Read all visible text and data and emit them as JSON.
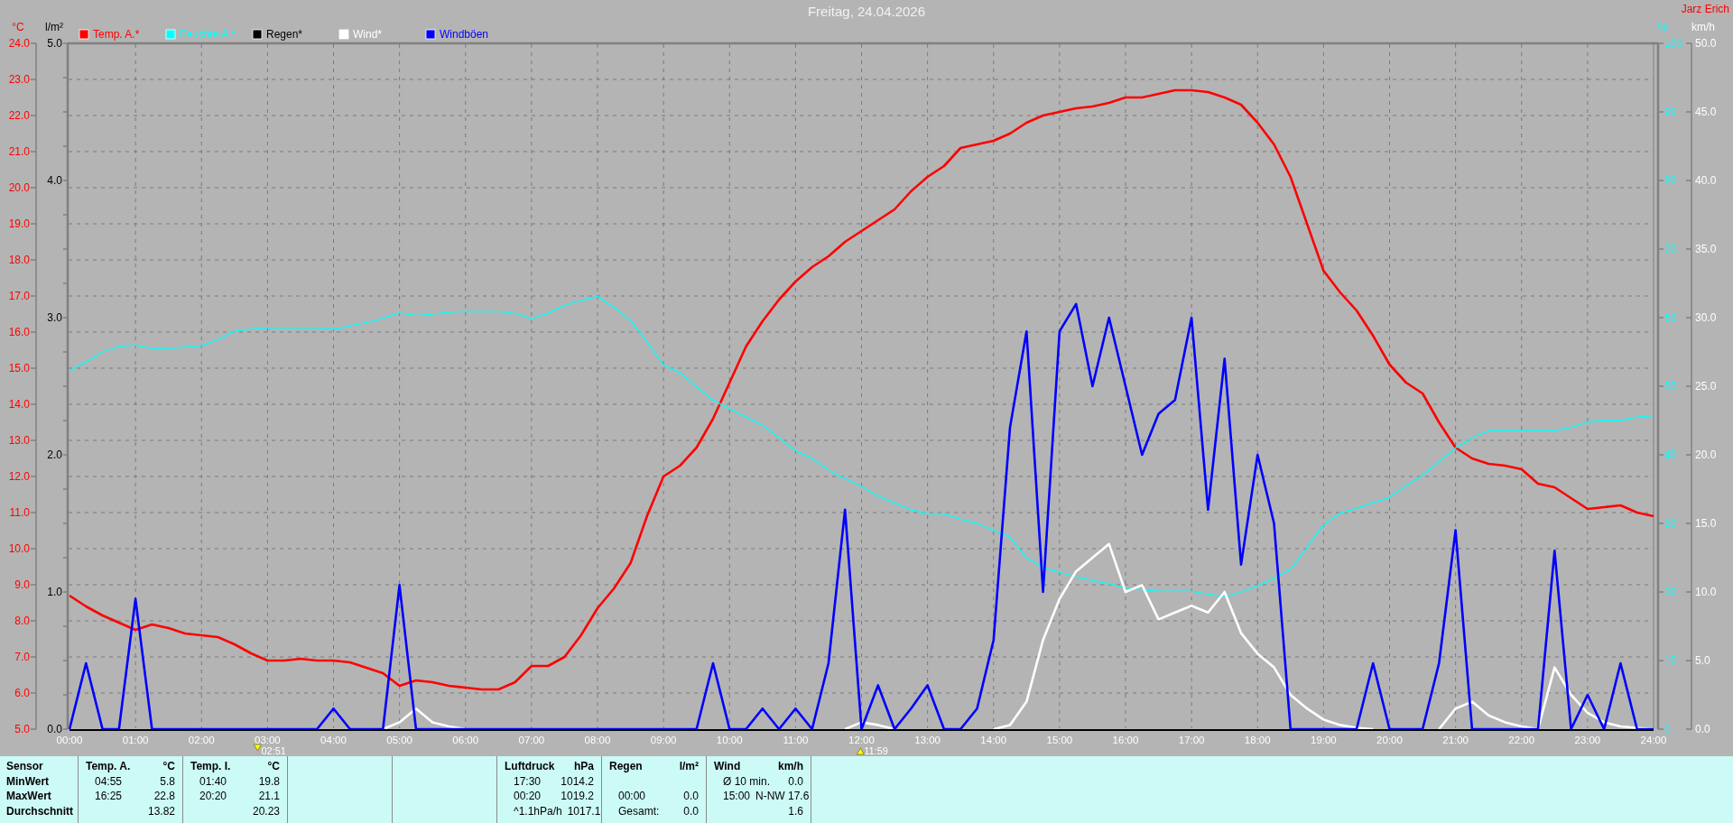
{
  "chart": {
    "title": "Freitag, 24.04.2026",
    "author": "Jarz Erich",
    "charts": [
      {
        "chart_data": {
          "type": "line",
          "ylabel": "°C",
          "xlim": [
            0,
            24
          ],
          "ylim": [
            5,
            24
          ],
          "yticks": [
            {
              "value": 5,
              "label": "5.0"
            },
            {
              "value": 6,
              "label": "6.0"
            },
            {
              "value": 7,
              "label": "7.0"
            },
            {
              "value": 8,
              "label": "8.0"
            },
            {
              "value": 9,
              "label": "9.0"
            },
            {
              "value": 10,
              "label": "10.0"
            },
            {
              "value": 11,
              "label": "11.0"
            },
            {
              "value": 12,
              "label": "12.0"
            },
            {
              "value": 13,
              "label": "13.0"
            },
            {
              "value": 14,
              "label": "14.0"
            },
            {
              "value": 15,
              "label": "15.0"
            },
            {
              "value": 16,
              "label": "16.0"
            },
            {
              "value": 17,
              "label": "17.0"
            },
            {
              "value": 18,
              "label": "18.0"
            },
            {
              "value": 19,
              "label": "19.0"
            },
            {
              "value": 20,
              "label": "20.0"
            },
            {
              "value": 21,
              "label": "21.0"
            },
            {
              "value": 22,
              "label": "22.0"
            },
            {
              "value": 23,
              "label": "23.0"
            },
            {
              "value": 24,
              "label": "24.0"
            }
          ],
          "xticks": [
            {
              "value": 0,
              "label": "00:00"
            },
            {
              "value": 1,
              "label": "01:00"
            },
            {
              "value": 2,
              "label": "02:00"
            },
            {
              "value": 3,
              "label": "03:00"
            },
            {
              "value": 4,
              "label": "04:00"
            },
            {
              "value": 5,
              "label": "05:00"
            },
            {
              "value": 6,
              "label": "06:00"
            },
            {
              "value": 7,
              "label": "07:00"
            },
            {
              "value": 8,
              "label": "08:00"
            },
            {
              "value": 9,
              "label": "09:00"
            },
            {
              "value": 10,
              "label": "10:00"
            },
            {
              "value": 11,
              "label": "11:00"
            },
            {
              "value": 12,
              "label": "12:00"
            },
            {
              "value": 13,
              "label": "13:00"
            },
            {
              "value": 14,
              "label": "14:00"
            },
            {
              "value": 15,
              "label": "15:00"
            },
            {
              "value": 16,
              "label": "16:00"
            },
            {
              "value": 17,
              "label": "17:00"
            },
            {
              "value": 18,
              "label": "18:00"
            },
            {
              "value": 19,
              "label": "19:00"
            },
            {
              "value": 20,
              "label": "20:00"
            },
            {
              "value": 21,
              "label": "21:00"
            },
            {
              "value": 22,
              "label": "22:00"
            },
            {
              "value": 23,
              "label": "23:00"
            },
            {
              "value": 24,
              "label": "24:00"
            }
          ],
          "x": [
            0,
            0.25,
            0.5,
            0.75,
            1,
            1.25,
            1.5,
            1.75,
            2,
            2.25,
            2.5,
            2.75,
            3,
            3.25,
            3.5,
            3.75,
            4,
            4.25,
            4.5,
            4.75,
            5,
            5.25,
            5.5,
            5.75,
            6,
            6.25,
            6.5,
            6.75,
            7,
            7.25,
            7.5,
            7.75,
            8,
            8.25,
            8.5,
            8.75,
            9,
            9.25,
            9.5,
            9.75,
            10,
            10.25,
            10.5,
            10.75,
            11,
            11.25,
            11.5,
            11.75,
            12,
            12.25,
            12.5,
            12.75,
            13,
            13.25,
            13.5,
            13.75,
            14,
            14.25,
            14.5,
            14.75,
            15,
            15.25,
            15.5,
            15.75,
            16,
            16.25,
            16.5,
            16.75,
            17,
            17.25,
            17.5,
            17.75,
            18,
            18.25,
            18.5,
            18.75,
            19,
            19.25,
            19.5,
            19.75,
            20,
            20.25,
            20.5,
            20.75,
            21,
            21.25,
            21.5,
            21.75,
            22,
            22.25,
            22.5,
            22.75,
            23,
            23.25,
            23.5,
            23.75,
            24
          ],
          "series": [
            {
              "name": "Temp. A.*",
              "color": "#ff0000",
              "values": [
                8.7,
                8.4,
                8.15,
                7.95,
                7.75,
                7.9,
                7.8,
                7.65,
                7.6,
                7.55,
                7.35,
                7.1,
                6.9,
                6.9,
                6.95,
                6.9,
                6.9,
                6.85,
                6.7,
                6.55,
                6.2,
                6.35,
                6.3,
                6.2,
                6.15,
                6.1,
                6.1,
                6.3,
                6.75,
                6.75,
                7.0,
                7.6,
                8.35,
                8.9,
                9.6,
                10.9,
                12.0,
                12.3,
                12.8,
                13.6,
                14.6,
                15.6,
                16.3,
                16.9,
                17.4,
                17.8,
                18.1,
                18.5,
                18.8,
                19.1,
                19.4,
                19.9,
                20.3,
                20.6,
                21.1,
                21.2,
                21.3,
                21.5,
                21.8,
                22.0,
                22.1,
                22.2,
                22.25,
                22.35,
                22.5,
                22.5,
                22.6,
                22.7,
                22.7,
                22.65,
                22.5,
                22.3,
                21.8,
                21.2,
                20.3,
                19.0,
                17.7,
                17.1,
                16.6,
                15.9,
                15.1,
                14.6,
                14.3,
                13.5,
                12.8,
                12.5,
                12.35,
                12.3,
                12.2,
                11.8,
                11.7,
                11.4,
                11.1,
                11.15,
                11.2,
                11.0,
                10.9
              ]
            }
          ],
          "annotations": [
            "02:51",
            "11:59"
          ],
          "legend": "top"
        }
      },
      {
        "chart_data": {
          "type": "line",
          "legend": "top",
          "ylabel": "%",
          "xlim": [
            0,
            24
          ],
          "ylim": [
            0,
            100
          ],
          "yticks": [
            0,
            10,
            20,
            30,
            40,
            50,
            60,
            70,
            80,
            90,
            100
          ],
          "x": [
            0,
            0.25,
            0.5,
            0.75,
            1,
            1.25,
            1.5,
            1.75,
            2,
            2.25,
            2.5,
            2.75,
            3,
            3.25,
            3.5,
            3.75,
            4,
            4.25,
            4.5,
            4.75,
            5,
            5.25,
            5.5,
            5.75,
            6,
            6.25,
            6.5,
            6.75,
            7,
            7.25,
            7.5,
            7.75,
            8,
            8.25,
            8.5,
            8.75,
            9,
            9.25,
            9.5,
            9.75,
            10,
            10.25,
            10.5,
            10.75,
            11,
            11.25,
            11.5,
            11.75,
            12,
            12.25,
            12.5,
            12.75,
            13,
            13.25,
            13.5,
            13.75,
            14,
            14.25,
            14.5,
            14.75,
            15,
            15.25,
            15.5,
            15.75,
            16,
            16.25,
            16.5,
            16.75,
            17,
            17.25,
            17.5,
            17.75,
            18,
            18.25,
            18.5,
            18.75,
            19,
            19.25,
            19.5,
            19.75,
            20,
            20.25,
            20.5,
            20.75,
            21,
            21.25,
            21.5,
            21.75,
            22,
            22.25,
            22.5,
            22.75,
            23,
            23.25,
            23.5,
            23.75,
            24
          ],
          "series": [
            {
              "name": "Feuchte A.*",
              "color": "#00ffff",
              "values": [
                52.3,
                53.5,
                55,
                55.8,
                56,
                55.5,
                55.5,
                55.7,
                55.9,
                56.8,
                58,
                58.3,
                58.5,
                58.5,
                58.5,
                58.5,
                58.3,
                58.8,
                59.3,
                59.9,
                60.7,
                60.3,
                60.5,
                60.8,
                60.9,
                60.9,
                60.9,
                60.6,
                59.9,
                60.6,
                61.8,
                62.5,
                63.1,
                61.5,
                59.6,
                56.5,
                53.1,
                52,
                49.9,
                48,
                46.7,
                45.5,
                44.3,
                42.5,
                40.6,
                39.5,
                37.8,
                36.5,
                35.4,
                34,
                33,
                32,
                31.4,
                31.4,
                30.6,
                30,
                29,
                28,
                25,
                23.5,
                22.9,
                22.2,
                21.7,
                21.2,
                20.6,
                20.3,
                20.1,
                20.1,
                20.1,
                19.7,
                19.3,
                20,
                20.9,
                22,
                23.3,
                26.5,
                29.8,
                31.5,
                32.2,
                33,
                33.8,
                35.5,
                37,
                39,
                41,
                42.5,
                43.5,
                43.5,
                43.5,
                43.5,
                43.5,
                44,
                44.8,
                45,
                45,
                45.5,
                45.7
              ]
            }
          ]
        }
      },
      {
        "chart_data": {
          "type": "line",
          "legend": "top",
          "ylabel": "l/m²",
          "xlim": [
            0,
            24
          ],
          "ylim": [
            0,
            5
          ],
          "yticks": [
            {
              "value": 0,
              "label": "0.0"
            },
            {
              "value": 1,
              "label": "1.0"
            },
            {
              "value": 2,
              "label": "2.0"
            },
            {
              "value": 3,
              "label": "3.0"
            },
            {
              "value": 4,
              "label": "4.0"
            },
            {
              "value": 5,
              "label": "5.0"
            }
          ],
          "x": [
            0,
            0.25,
            0.5,
            0.75,
            1,
            1.25,
            1.5,
            1.75,
            2,
            2.25,
            2.5,
            2.75,
            3,
            3.25,
            3.5,
            3.75,
            4,
            4.25,
            4.5,
            4.75,
            5,
            5.25,
            5.5,
            5.75,
            6,
            6.25,
            6.5,
            6.75,
            7,
            7.25,
            7.5,
            7.75,
            8,
            8.25,
            8.5,
            8.75,
            9,
            9.25,
            9.5,
            9.75,
            10,
            10.25,
            10.5,
            10.75,
            11,
            11.25,
            11.5,
            11.75,
            12,
            12.25,
            12.5,
            12.75,
            13,
            13.25,
            13.5,
            13.75,
            14,
            14.25,
            14.5,
            14.75,
            15,
            15.25,
            15.5,
            15.75,
            16,
            16.25,
            16.5,
            16.75,
            17,
            17.25,
            17.5,
            17.75,
            18,
            18.25,
            18.5,
            18.75,
            19,
            19.25,
            19.5,
            19.75,
            20,
            20.25,
            20.5,
            20.75,
            21,
            21.25,
            21.5,
            21.75,
            22,
            22.25,
            22.5,
            22.75,
            23,
            23.25,
            23.5,
            23.75,
            24
          ],
          "series": [
            {
              "name": "Regen*",
              "color": "#000000",
              "values": [
                0,
                0,
                0,
                0,
                0,
                0,
                0,
                0,
                0,
                0,
                0,
                0,
                0,
                0,
                0,
                0,
                0,
                0,
                0,
                0,
                0,
                0,
                0,
                0,
                0,
                0,
                0,
                0,
                0,
                0,
                0,
                0,
                0,
                0,
                0,
                0,
                0,
                0,
                0,
                0,
                0,
                0,
                0,
                0,
                0,
                0,
                0,
                0,
                0,
                0,
                0,
                0,
                0,
                0,
                0,
                0,
                0,
                0,
                0,
                0,
                0,
                0,
                0,
                0,
                0,
                0,
                0,
                0,
                0,
                0,
                0,
                0,
                0,
                0,
                0,
                0,
                0,
                0,
                0,
                0,
                0,
                0,
                0,
                0,
                0,
                0,
                0,
                0,
                0,
                0,
                0,
                0,
                0,
                0,
                0,
                0,
                0
              ]
            }
          ]
        }
      },
      {
        "chart_data": {
          "type": "line",
          "legend": "top",
          "ylabel": "km/h",
          "xlim": [
            0,
            24
          ],
          "ylim": [
            0,
            50
          ],
          "yticks": [
            {
              "value": 0,
              "label": "0.0"
            },
            {
              "value": 5,
              "label": "5.0"
            },
            {
              "value": 10,
              "label": "10.0"
            },
            {
              "value": 15,
              "label": "15.0"
            },
            {
              "value": 20,
              "label": "20.0"
            },
            {
              "value": 25,
              "label": "25.0"
            },
            {
              "value": 30,
              "label": "30.0"
            },
            {
              "value": 35,
              "label": "35.0"
            },
            {
              "value": 40,
              "label": "40.0"
            },
            {
              "value": 45,
              "label": "45.0"
            },
            {
              "value": 50,
              "label": "50.0"
            }
          ],
          "x": [
            0,
            0.25,
            0.5,
            0.75,
            1,
            1.25,
            1.5,
            1.75,
            2,
            2.25,
            2.5,
            2.75,
            3,
            3.25,
            3.5,
            3.75,
            4,
            4.25,
            4.5,
            4.75,
            5,
            5.25,
            5.5,
            5.75,
            6,
            6.25,
            6.5,
            6.75,
            7,
            7.25,
            7.5,
            7.75,
            8,
            8.25,
            8.5,
            8.75,
            9,
            9.25,
            9.5,
            9.75,
            10,
            10.25,
            10.5,
            10.75,
            11,
            11.25,
            11.5,
            11.75,
            12,
            12.25,
            12.5,
            12.75,
            13,
            13.25,
            13.5,
            13.75,
            14,
            14.25,
            14.5,
            14.75,
            15,
            15.25,
            15.5,
            15.75,
            16,
            16.25,
            16.5,
            16.75,
            17,
            17.25,
            17.5,
            17.75,
            18,
            18.25,
            18.5,
            18.75,
            19,
            19.25,
            19.5,
            19.75,
            20,
            20.25,
            20.5,
            20.75,
            21,
            21.25,
            21.5,
            21.75,
            22,
            22.25,
            22.5,
            22.75,
            23,
            23.25,
            23.5,
            23.75,
            24
          ],
          "series": [
            {
              "name": "Wind*",
              "color": "#ffffff",
              "values": [
                null,
                null,
                null,
                null,
                null,
                null,
                null,
                null,
                null,
                null,
                null,
                null,
                null,
                null,
                null,
                null,
                null,
                null,
                null,
                0,
                0.5,
                1.5,
                0.5,
                0.2,
                0,
                null,
                null,
                null,
                null,
                null,
                null,
                null,
                null,
                null,
                null,
                null,
                null,
                null,
                null,
                null,
                null,
                null,
                null,
                null,
                null,
                null,
                null,
                0,
                0.5,
                0.3,
                0,
                null,
                null,
                null,
                null,
                null,
                0,
                0.3,
                2,
                6.5,
                9.5,
                11.5,
                12.5,
                13.5,
                10,
                10.5,
                8,
                8.5,
                9,
                8.5,
                10,
                7,
                5.5,
                4.5,
                2.5,
                1.5,
                0.7,
                0.3,
                0.1,
                0,
                null,
                null,
                null,
                0,
                1.5,
                2,
                1,
                0.5,
                0.2,
                0,
                4.5,
                2.5,
                1.2,
                0.5,
                0.2,
                0.1,
                0
              ]
            },
            {
              "name": "Windböen",
              "color": "#0000ff",
              "values": [
                0,
                4.8,
                0,
                0,
                9.5,
                0,
                0,
                0,
                0,
                0,
                0,
                0,
                0,
                0,
                0,
                0,
                1.5,
                0,
                0,
                0,
                10.5,
                0,
                0,
                0,
                0,
                0,
                0,
                0,
                0,
                0,
                0,
                0,
                0,
                0,
                0,
                0,
                0,
                0,
                0,
                4.8,
                0,
                0,
                1.5,
                0,
                1.5,
                0,
                4.8,
                16,
                0,
                3.2,
                0,
                1.5,
                3.2,
                0,
                0,
                1.5,
                6.5,
                22,
                29,
                10,
                29,
                31,
                25,
                30,
                25,
                20,
                23,
                24,
                30,
                16,
                27,
                12,
                20,
                15,
                0,
                0,
                0,
                0,
                0,
                4.8,
                0,
                0,
                0,
                4.8,
                14.5,
                0,
                0,
                0,
                0,
                0,
                13,
                0,
                2.5,
                0,
                4.8,
                0,
                0
              ]
            }
          ]
        }
      }
    ],
    "time_markers": [
      {
        "kind": "down"
      },
      {
        "kind": "up"
      }
    ]
  },
  "stats_table": {
    "row_labels": [
      "Sensor",
      "MinWert",
      "MaxWert",
      "Durchschnitt"
    ],
    "groups": [
      {
        "kind": "data",
        "title": "Temp. A.",
        "unit": "°C",
        "rows": [
          {
            "time": "04:55",
            "value": "5.8"
          },
          {
            "time": "16:25",
            "value": "22.8"
          },
          {
            "value": "13.82"
          }
        ]
      },
      {
        "kind": "data",
        "title": "Temp. I.",
        "unit": "°C",
        "rows": [
          {
            "time": "01:40",
            "value": "19.8"
          },
          {
            "time": "20:20",
            "value": "21.1"
          },
          {
            "value": "20.23"
          }
        ]
      },
      {
        "kind": "blank"
      },
      {
        "kind": "blank"
      },
      {
        "kind": "data",
        "title": "Luftdruck",
        "unit": "hPa",
        "rows": [
          {
            "time": "17:30",
            "value": "1014.2"
          },
          {
            "time": "00:20",
            "value": "1019.2"
          },
          {
            "time": "^1.1hPa/h",
            "value": "1017.1"
          }
        ]
      },
      {
        "kind": "data",
        "title": "Regen",
        "unit": "l/m²",
        "rows": [
          {},
          {
            "time": "00:00",
            "value": "0.0"
          },
          {
            "time": "Gesamt:",
            "value": "0.0"
          }
        ]
      },
      {
        "kind": "data",
        "title": "Wind",
        "unit": "km/h",
        "rows": [
          {
            "time": "Ø 10 min.",
            "value": "0.0"
          },
          {
            "time": "15:00",
            "value": "N-NW 17.6"
          },
          {
            "value": "1.6"
          }
        ]
      }
    ]
  }
}
